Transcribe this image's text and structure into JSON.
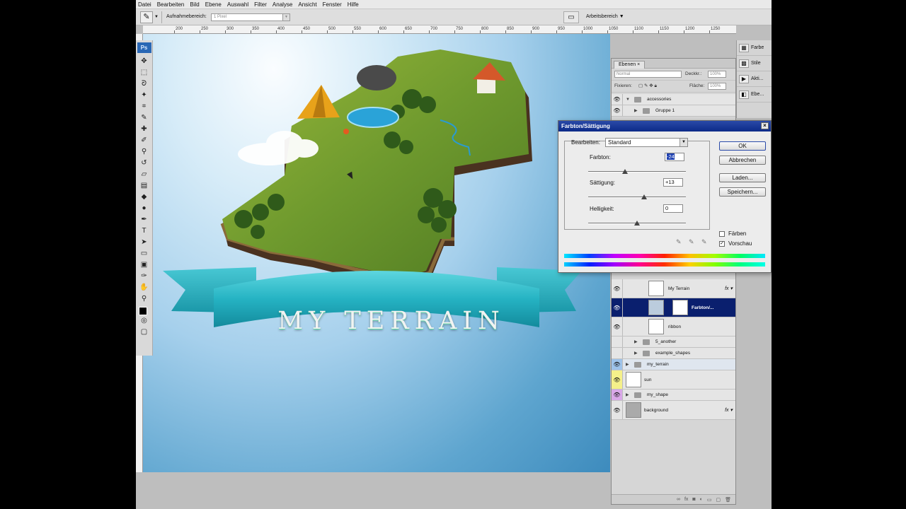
{
  "menu": [
    "Datei",
    "Bearbeiten",
    "Bild",
    "Ebene",
    "Auswahl",
    "Filter",
    "Analyse",
    "Ansicht",
    "Fenster",
    "Hilfe"
  ],
  "options_bar": {
    "sample_label": "Aufnahmebereich:",
    "sample_value": "1 Pixel",
    "workspace_label": "Arbeitsbereich"
  },
  "ruler_ticks": [
    "200",
    "250",
    "300",
    "350",
    "400",
    "450",
    "500",
    "550",
    "600",
    "650",
    "700",
    "750",
    "800",
    "850",
    "900",
    "950",
    "1000",
    "1050",
    "1100",
    "1150",
    "1200",
    "1250"
  ],
  "toolbox": {
    "badge": "Ps"
  },
  "dock": {
    "items": [
      "Farbe",
      "Stile",
      "Akti...",
      "Ebe..."
    ]
  },
  "artwork": {
    "banner_text": "MY TERRAIN"
  },
  "layers_panel": {
    "tab": "Ebenen",
    "blend_mode": "Normal",
    "opacity_label": "Deckkr.:",
    "opacity_value": "100%",
    "lock_label": "Fixieren:",
    "fill_label": "Fläche:",
    "fill_value": "100%",
    "layers": [
      {
        "name": "accessories",
        "kind": "group",
        "indent": 0,
        "visible": true
      },
      {
        "name": "Gruppe 1",
        "kind": "group",
        "indent": 1,
        "visible": true
      },
      {
        "name": "My Terrain",
        "kind": "layer",
        "indent": 2,
        "visible": true,
        "fx": true
      },
      {
        "name": "Farbton/...",
        "kind": "adjustment",
        "indent": 2,
        "visible": true,
        "selected": true
      },
      {
        "name": "ribbon",
        "kind": "layer",
        "indent": 2,
        "visible": true
      },
      {
        "name": "5_another",
        "kind": "group",
        "indent": 1,
        "visible": false
      },
      {
        "name": "example_shapes",
        "kind": "group",
        "indent": 1,
        "visible": false
      },
      {
        "name": "my_terrain",
        "kind": "group",
        "indent": 0,
        "visible": true
      },
      {
        "name": "sun",
        "kind": "layer",
        "indent": 0,
        "visible": true
      },
      {
        "name": "my_shape",
        "kind": "group",
        "indent": 0,
        "visible": true
      },
      {
        "name": "background",
        "kind": "layer",
        "indent": 0,
        "visible": true,
        "fx": true
      }
    ]
  },
  "dialog": {
    "title": "Farbton/Sättigung",
    "edit_label": "Bearbeiten:",
    "edit_value": "Standard",
    "hue_label": "Farbton:",
    "hue_value": "-24",
    "saturation_label": "Sättigung:",
    "saturation_value": "+13",
    "lightness_label": "Helligkeit:",
    "lightness_value": "0",
    "colorize_label": "Färben",
    "preview_label": "Vorschau",
    "colorize_checked": false,
    "preview_checked": true,
    "buttons": {
      "ok": "OK",
      "cancel": "Abbrechen",
      "load": "Laden...",
      "save": "Speichern..."
    }
  },
  "colors": {
    "selection": "#0a1f6e",
    "dialog_title": "#1c3a98",
    "ribbon": "#2bb6c6",
    "grass": "#5f8f2a"
  }
}
